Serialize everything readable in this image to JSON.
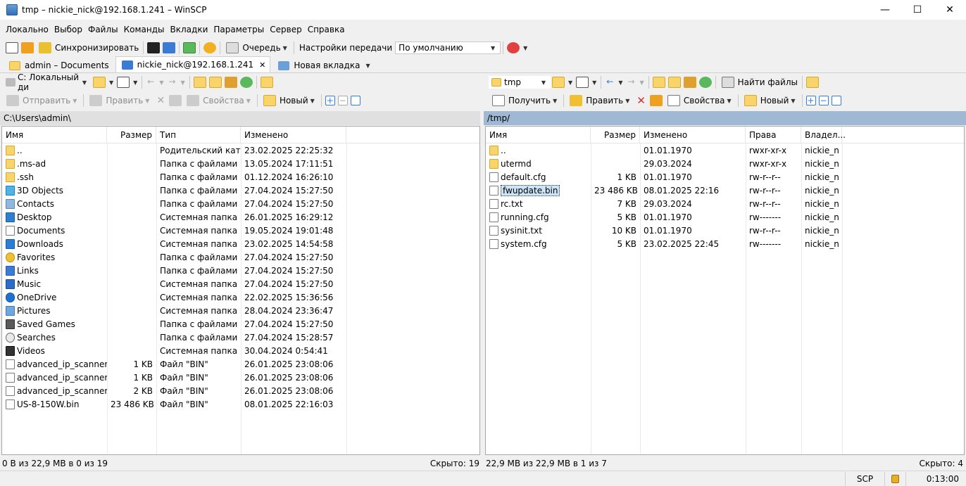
{
  "window": {
    "title": "tmp – nickie_nick@192.168.1.241 – WinSCP",
    "minimize": "—",
    "maximize": "☐",
    "close": "✕"
  },
  "menu": [
    "Локально",
    "Выбор",
    "Файлы",
    "Команды",
    "Вкладки",
    "Параметры",
    "Сервер",
    "Справка"
  ],
  "toolbar": {
    "sync": "Синхронизировать",
    "queue": "Очередь",
    "transfer_settings": "Настройки передачи",
    "transfer_profile": "По умолчанию"
  },
  "tabs": [
    {
      "label": "admin – Documents"
    },
    {
      "label": "nickie_nick@192.168.1.241",
      "close": "✕"
    },
    {
      "label": "Новая вкладка"
    }
  ],
  "local": {
    "drive": "C: Локальный ди",
    "actions": {
      "send": "Отправить",
      "edit": "Править",
      "properties": "Свойства",
      "new": "Новый"
    },
    "path": "C:\\Users\\admin\\",
    "columns": {
      "name": "Имя",
      "size": "Размер",
      "type": "Тип",
      "modified": "Изменено"
    },
    "files": [
      {
        "name": "..",
        "icon": "up",
        "size": "",
        "type": "Родительский кат...",
        "modified": "23.02.2025 22:25:32"
      },
      {
        "name": ".ms-ad",
        "icon": "folder",
        "size": "",
        "type": "Папка с файлами",
        "modified": "13.05.2024 17:11:51"
      },
      {
        "name": ".ssh",
        "icon": "folder",
        "size": "",
        "type": "Папка с файлами",
        "modified": "01.12.2024 16:26:10"
      },
      {
        "name": "3D Objects",
        "icon": "obj",
        "size": "",
        "type": "Папка с файлами",
        "modified": "27.04.2024 15:27:50"
      },
      {
        "name": "Contacts",
        "icon": "contact",
        "size": "",
        "type": "Папка с файлами",
        "modified": "27.04.2024 15:27:50"
      },
      {
        "name": "Desktop",
        "icon": "desk",
        "size": "",
        "type": "Системная папка",
        "modified": "26.01.2025 16:29:12"
      },
      {
        "name": "Documents",
        "icon": "file",
        "size": "",
        "type": "Системная папка",
        "modified": "19.05.2024 19:01:48"
      },
      {
        "name": "Downloads",
        "icon": "dl",
        "size": "",
        "type": "Системная папка",
        "modified": "23.02.2025 14:54:58"
      },
      {
        "name": "Favorites",
        "icon": "star",
        "size": "",
        "type": "Папка с файлами",
        "modified": "27.04.2024 15:27:50"
      },
      {
        "name": "Links",
        "icon": "link",
        "size": "",
        "type": "Папка с файлами",
        "modified": "27.04.2024 15:27:50"
      },
      {
        "name": "Music",
        "icon": "music",
        "size": "",
        "type": "Системная папка",
        "modified": "27.04.2024 15:27:50"
      },
      {
        "name": "OneDrive",
        "icon": "cloud",
        "size": "",
        "type": "Системная папка",
        "modified": "22.02.2025 15:36:56"
      },
      {
        "name": "Pictures",
        "icon": "pic",
        "size": "",
        "type": "Системная папка",
        "modified": "28.04.2024 23:36:47"
      },
      {
        "name": "Saved Games",
        "icon": "game",
        "size": "",
        "type": "Папка с файлами",
        "modified": "27.04.2024 15:27:50"
      },
      {
        "name": "Searches",
        "icon": "search",
        "size": "",
        "type": "Папка с файлами",
        "modified": "27.04.2024 15:28:57"
      },
      {
        "name": "Videos",
        "icon": "video",
        "size": "",
        "type": "Системная папка",
        "modified": "30.04.2024 0:54:41"
      },
      {
        "name": "advanced_ip_scanner...",
        "icon": "file",
        "size": "1 KB",
        "type": "Файл \"BIN\"",
        "modified": "26.01.2025 23:08:06"
      },
      {
        "name": "advanced_ip_scanner...",
        "icon": "file",
        "size": "1 KB",
        "type": "Файл \"BIN\"",
        "modified": "26.01.2025 23:08:06"
      },
      {
        "name": "advanced_ip_scanner...",
        "icon": "file",
        "size": "2 KB",
        "type": "Файл \"BIN\"",
        "modified": "26.01.2025 23:08:06"
      },
      {
        "name": "US-8-150W.bin",
        "icon": "file",
        "size": "23 486 KB",
        "type": "Файл \"BIN\"",
        "modified": "08.01.2025 22:16:03"
      }
    ],
    "status_left": "0 B из 22,9 MB в 0 из 19",
    "status_right": "Скрыто: 19"
  },
  "remote": {
    "dir": "tmp",
    "find": "Найти файлы",
    "actions": {
      "get": "Получить",
      "edit": "Править",
      "properties": "Свойства",
      "new": "Новый"
    },
    "path": "/tmp/",
    "columns": {
      "name": "Имя",
      "size": "Размер",
      "modified": "Изменено",
      "rights": "Права",
      "owner": "Владел..."
    },
    "files": [
      {
        "name": "..",
        "icon": "up",
        "size": "",
        "modified": "01.01.1970",
        "rights": "rwxr-xr-x",
        "owner": "nickie_n"
      },
      {
        "name": "utermd",
        "icon": "folder",
        "size": "",
        "modified": "29.03.2024",
        "rights": "rwxr-xr-x",
        "owner": "nickie_n"
      },
      {
        "name": "default.cfg",
        "icon": "file",
        "size": "1 KB",
        "modified": "01.01.1970",
        "rights": "rw-r--r--",
        "owner": "nickie_n"
      },
      {
        "name": "fwupdate.bin",
        "icon": "file",
        "size": "23 486 KB",
        "modified": "08.01.2025 22:16",
        "rights": "rw-r--r--",
        "owner": "nickie_n",
        "selected": true
      },
      {
        "name": "rc.txt",
        "icon": "file",
        "size": "7 KB",
        "modified": "29.03.2024",
        "rights": "rw-r--r--",
        "owner": "nickie_n"
      },
      {
        "name": "running.cfg",
        "icon": "file",
        "size": "5 KB",
        "modified": "01.01.1970",
        "rights": "rw-------",
        "owner": "nickie_n"
      },
      {
        "name": "sysinit.txt",
        "icon": "file",
        "size": "10 KB",
        "modified": "01.01.1970",
        "rights": "rw-r--r--",
        "owner": "nickie_n"
      },
      {
        "name": "system.cfg",
        "icon": "file",
        "size": "5 KB",
        "modified": "23.02.2025 22:45",
        "rights": "rw-------",
        "owner": "nickie_n"
      }
    ],
    "status_left": "22,9 MB из 22,9 MB в 1 из 7",
    "status_right": "Скрыто: 4"
  },
  "bottom": {
    "protocol": "SCP",
    "timer": "0:13:00"
  }
}
